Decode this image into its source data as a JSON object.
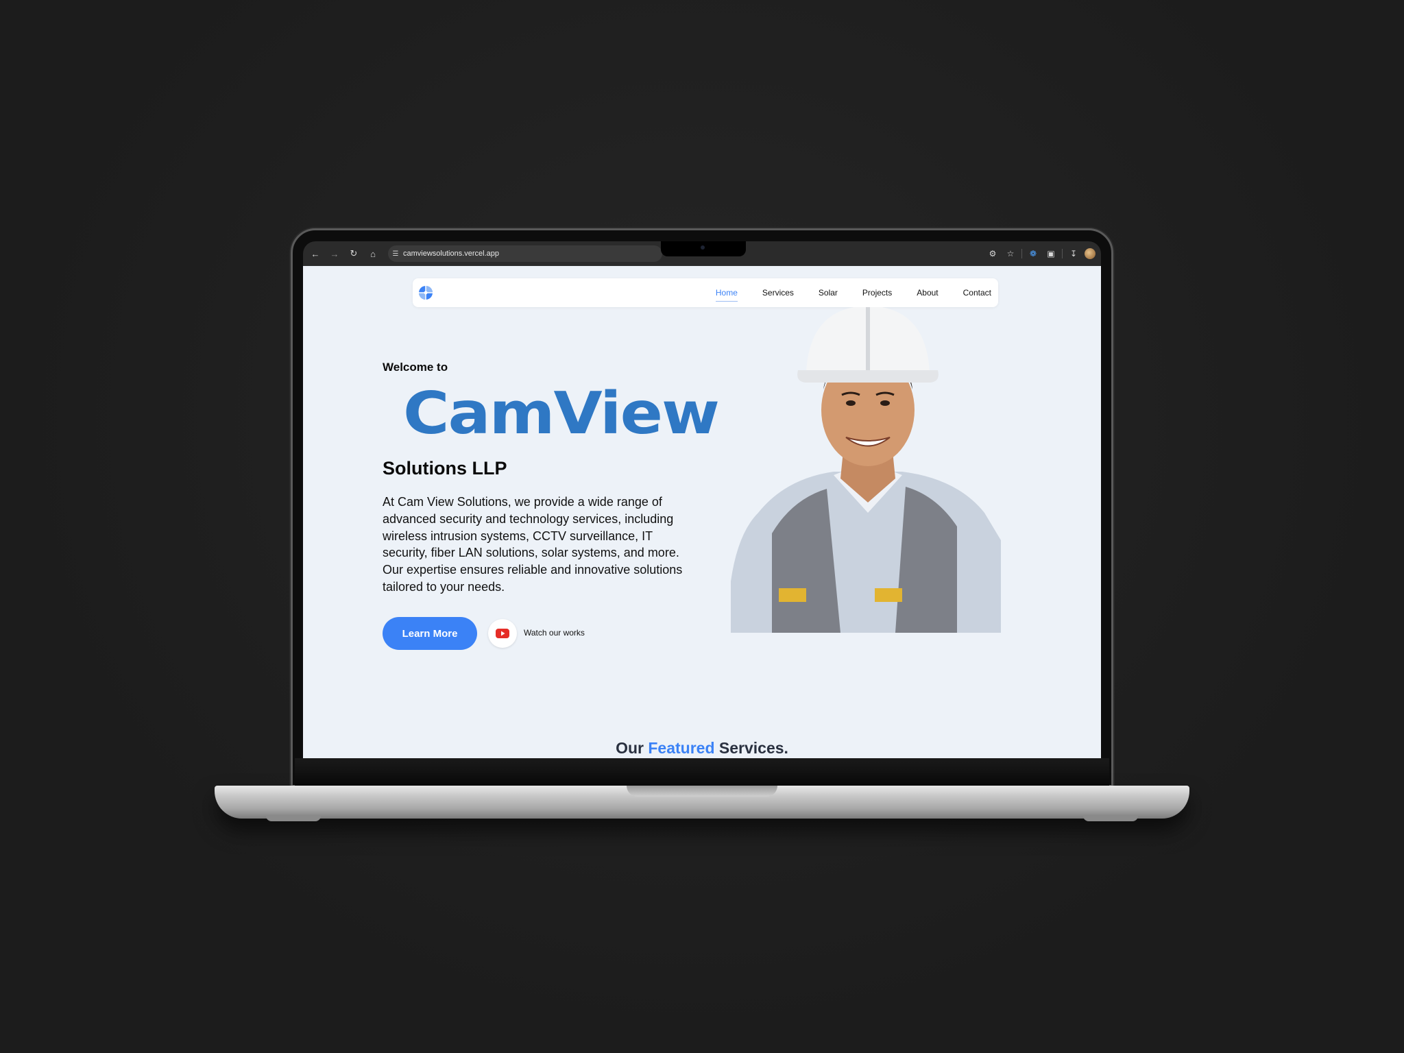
{
  "browser": {
    "url": "camviewsolutions.vercel.app",
    "nav_icons": [
      "back-arrow-icon",
      "forward-arrow-icon",
      "reload-icon",
      "home-icon"
    ],
    "right_icons": [
      "translate-icon",
      "bookmark-star-icon",
      "extension-icon",
      "puzzle-icon",
      "download-icon",
      "profile-avatar"
    ]
  },
  "site": {
    "nav": {
      "items": [
        {
          "label": "Home",
          "active": true
        },
        {
          "label": "Services"
        },
        {
          "label": "Solar"
        },
        {
          "label": "Projects"
        },
        {
          "label": "About"
        },
        {
          "label": "Contact"
        }
      ]
    },
    "hero": {
      "welcome": "Welcome to",
      "brand": "CamView",
      "subtitle": "Solutions LLP",
      "description": "At Cam View Solutions, we provide a wide range of advanced security and technology services, including wireless intrusion systems, CCTV surveillance, IT security, fiber LAN solutions, solar systems, and more. Our expertise ensures reliable and innovative solutions tailored to your needs.",
      "cta_label": "Learn More",
      "watch_label": "Watch our works"
    },
    "featured": {
      "prefix": "Our",
      "accent": "Featured",
      "suffix": "Services."
    }
  },
  "colors": {
    "accent": "#3b82f6",
    "brand": "#2f78c4",
    "page_bg": "#edf2f8"
  }
}
